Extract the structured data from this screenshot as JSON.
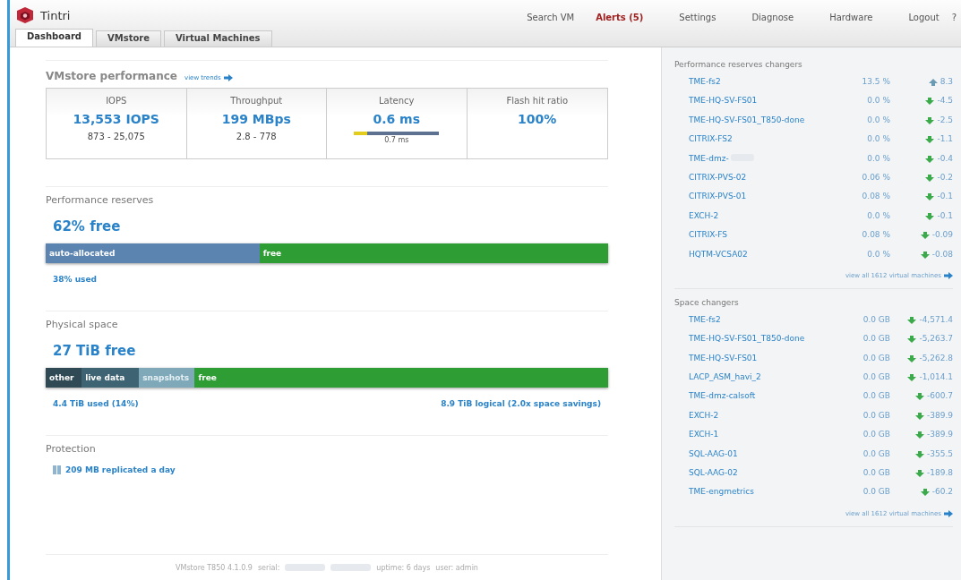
{
  "logo": {
    "text": "Tintri"
  },
  "nav": [
    {
      "label": "Search VM",
      "kind": "plain"
    },
    {
      "label": "Alerts (5)",
      "kind": "alert"
    },
    {
      "label": "Settings",
      "kind": "plain"
    },
    {
      "label": "Diagnose",
      "kind": "plain"
    },
    {
      "label": "Hardware",
      "kind": "plain"
    },
    {
      "label": "Logout",
      "kind": "plain"
    },
    {
      "label": "?",
      "kind": "plain"
    }
  ],
  "tabs": [
    {
      "label": "Dashboard",
      "selected": true
    },
    {
      "label": "VMstore",
      "selected": false
    },
    {
      "label": "Virtual Machines",
      "selected": false
    }
  ],
  "performance": {
    "title": "VMstore performance",
    "link": "view trends",
    "metrics": [
      {
        "label": "IOPS",
        "value": "13,553 IOPS",
        "range": "873 - 25,075"
      },
      {
        "label": "Throughput",
        "value": "199 MBps",
        "range": "2.8 - 778"
      },
      {
        "label": "Latency",
        "value": "0.6 ms",
        "meter": {
          "level": 0.15,
          "reading": "0.7 ms"
        }
      },
      {
        "label": "Flash hit ratio",
        "value": "100%"
      }
    ]
  },
  "reserves": {
    "title": "Performance reserves",
    "headline": "62% free",
    "segments": [
      {
        "label": "auto-allocated",
        "color": "#5b84b1"
      },
      {
        "label": "free",
        "color": "#2e9e34"
      }
    ],
    "left_note": "38% used"
  },
  "physical": {
    "title": "Physical space",
    "headline": "27 TiB free",
    "segments": [
      {
        "label": "other",
        "color": "#2f4a55"
      },
      {
        "label": "live data",
        "color": "#3e6373"
      },
      {
        "label": "snapshots",
        "color": "#7fa8b8"
      },
      {
        "label": "free",
        "color": "#2e9e34"
      }
    ],
    "left_note": "4.4 TiB used (14%)",
    "right_note": "8.9 TiB logical (2.0x space savings)"
  },
  "protection": {
    "title": "Protection",
    "text": "209 MB replicated a day"
  },
  "footer": {
    "parts": [
      {
        "kind": "text",
        "text": "VMstore T850 4.1.0.9"
      },
      {
        "kind": "text",
        "text": "serial:"
      },
      {
        "kind": "redacted"
      },
      {
        "kind": "redacted"
      },
      {
        "kind": "text",
        "text": "uptime: 6 days"
      },
      {
        "kind": "text",
        "text": "user: admin"
      }
    ]
  },
  "reserve_changers": {
    "title": "Performance reserves changers",
    "link": "view all 1612 virtual machines",
    "rows": [
      {
        "name": "TME-fs2",
        "value": "13.5 %",
        "kind": "up",
        "change": "8.3"
      },
      {
        "name": "TME-HQ-SV-FS01",
        "value": "0.0 %",
        "kind": "down",
        "change": "-4.5"
      },
      {
        "name": "TME-HQ-SV-FS01_T850-done",
        "value": "0.0 %",
        "kind": "down",
        "change": "-2.5"
      },
      {
        "name": "CITRIX-FS2",
        "value": "0.0 %",
        "kind": "down",
        "change": "-1.1"
      },
      {
        "name": "TME-dmz-",
        "redacted": true,
        "value": "0.0 %",
        "kind": "down",
        "change": "-0.4"
      },
      {
        "name": "CITRIX-PVS-02",
        "value": "0.06 %",
        "kind": "down",
        "change": "-0.2"
      },
      {
        "name": "CITRIX-PVS-01",
        "value": "0.08 %",
        "kind": "down",
        "change": "-0.1"
      },
      {
        "name": "EXCH-2",
        "value": "0.0 %",
        "kind": "down",
        "change": "-0.1"
      },
      {
        "name": "CITRIX-FS",
        "value": "0.08 %",
        "kind": "down",
        "change": "-0.09"
      },
      {
        "name": "HQTM-VCSA02",
        "value": "0.0 %",
        "kind": "down",
        "change": "-0.08"
      }
    ]
  },
  "space_changers": {
    "title": "Space changers",
    "link": "view all 1612 virtual machines",
    "rows": [
      {
        "name": "TME-fs2",
        "value": "0.0 GB",
        "kind": "down",
        "change": "-4,571.4"
      },
      {
        "name": "TME-HQ-SV-FS01_T850-done",
        "value": "0.0 GB",
        "kind": "down",
        "change": "-5,263.7"
      },
      {
        "name": "TME-HQ-SV-FS01",
        "value": "0.0 GB",
        "kind": "down",
        "change": "-5,262.8"
      },
      {
        "name": "LACP_ASM_havi_2",
        "value": "0.0 GB",
        "kind": "down",
        "change": "-1,014.1"
      },
      {
        "name": "TME-dmz-calsoft",
        "value": "0.0 GB",
        "kind": "down",
        "change": "-600.7"
      },
      {
        "name": "EXCH-2",
        "value": "0.0 GB",
        "kind": "down",
        "change": "-389.9"
      },
      {
        "name": "EXCH-1",
        "value": "0.0 GB",
        "kind": "down",
        "change": "-389.9"
      },
      {
        "name": "SQL-AAG-01",
        "value": "0.0 GB",
        "kind": "down",
        "change": "-355.5"
      },
      {
        "name": "SQL-AAG-02",
        "value": "0.0 GB",
        "kind": "down",
        "change": "-189.8"
      },
      {
        "name": "TME-engmetrics",
        "value": "0.0 GB",
        "kind": "down",
        "change": "-60.2"
      }
    ]
  }
}
